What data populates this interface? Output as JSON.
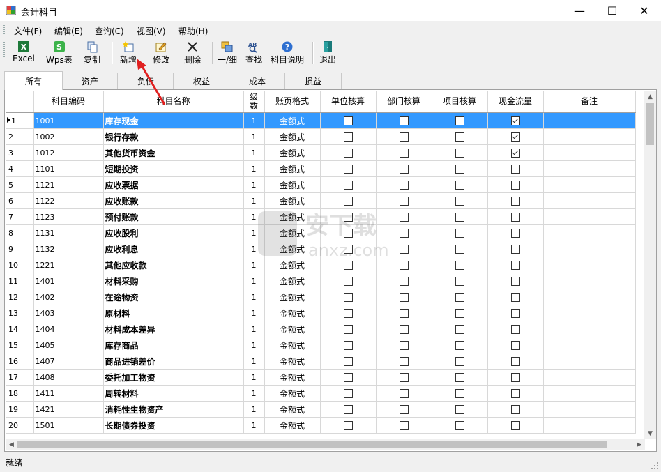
{
  "window": {
    "title": "会计科目",
    "minimize": "—",
    "maximize": "☐",
    "close": "✕"
  },
  "menu": [
    "文件(F)",
    "编辑(E)",
    "查询(C)",
    "视图(V)",
    "帮助(H)"
  ],
  "toolbar": {
    "excel": "Excel",
    "wps": "Wps表",
    "copy": "复制",
    "add": "新增",
    "edit": "修改",
    "delete": "删除",
    "level": "一/细",
    "find": "查找",
    "help": "科目说明",
    "exit": "退出"
  },
  "tabs": [
    "所有",
    "资产",
    "负债",
    "权益",
    "成本",
    "损益"
  ],
  "columns": {
    "code": "科目编码",
    "name": "科目名称",
    "level": "级数",
    "format": "账页格式",
    "unit": "单位核算",
    "dept": "部门核算",
    "project": "项目核算",
    "cash": "现金流量",
    "remark": "备注"
  },
  "rows": [
    {
      "no": "1",
      "code": "1001",
      "name": "库存现金",
      "level": "1",
      "format": "金额式",
      "unit": false,
      "dept": false,
      "project": false,
      "cash": true,
      "remark": ""
    },
    {
      "no": "2",
      "code": "1002",
      "name": "银行存款",
      "level": "1",
      "format": "金额式",
      "unit": false,
      "dept": false,
      "project": false,
      "cash": true,
      "remark": ""
    },
    {
      "no": "3",
      "code": "1012",
      "name": "其他货币资金",
      "level": "1",
      "format": "金额式",
      "unit": false,
      "dept": false,
      "project": false,
      "cash": true,
      "remark": ""
    },
    {
      "no": "4",
      "code": "1101",
      "name": "短期投资",
      "level": "1",
      "format": "金额式",
      "unit": false,
      "dept": false,
      "project": false,
      "cash": false,
      "remark": ""
    },
    {
      "no": "5",
      "code": "1121",
      "name": "应收票据",
      "level": "1",
      "format": "金额式",
      "unit": false,
      "dept": false,
      "project": false,
      "cash": false,
      "remark": ""
    },
    {
      "no": "6",
      "code": "1122",
      "name": "应收账款",
      "level": "1",
      "format": "金额式",
      "unit": false,
      "dept": false,
      "project": false,
      "cash": false,
      "remark": ""
    },
    {
      "no": "7",
      "code": "1123",
      "name": "预付账款",
      "level": "1",
      "format": "金额式",
      "unit": false,
      "dept": false,
      "project": false,
      "cash": false,
      "remark": ""
    },
    {
      "no": "8",
      "code": "1131",
      "name": "应收股利",
      "level": "1",
      "format": "金额式",
      "unit": false,
      "dept": false,
      "project": false,
      "cash": false,
      "remark": ""
    },
    {
      "no": "9",
      "code": "1132",
      "name": "应收利息",
      "level": "1",
      "format": "金额式",
      "unit": false,
      "dept": false,
      "project": false,
      "cash": false,
      "remark": ""
    },
    {
      "no": "10",
      "code": "1221",
      "name": "其他应收款",
      "level": "1",
      "format": "金额式",
      "unit": false,
      "dept": false,
      "project": false,
      "cash": false,
      "remark": ""
    },
    {
      "no": "11",
      "code": "1401",
      "name": "材料采购",
      "level": "1",
      "format": "金额式",
      "unit": false,
      "dept": false,
      "project": false,
      "cash": false,
      "remark": ""
    },
    {
      "no": "12",
      "code": "1402",
      "name": "在途物资",
      "level": "1",
      "format": "金额式",
      "unit": false,
      "dept": false,
      "project": false,
      "cash": false,
      "remark": ""
    },
    {
      "no": "13",
      "code": "1403",
      "name": "原材料",
      "level": "1",
      "format": "金额式",
      "unit": false,
      "dept": false,
      "project": false,
      "cash": false,
      "remark": ""
    },
    {
      "no": "14",
      "code": "1404",
      "name": "材料成本差异",
      "level": "1",
      "format": "金额式",
      "unit": false,
      "dept": false,
      "project": false,
      "cash": false,
      "remark": ""
    },
    {
      "no": "15",
      "code": "1405",
      "name": "库存商品",
      "level": "1",
      "format": "金额式",
      "unit": false,
      "dept": false,
      "project": false,
      "cash": false,
      "remark": ""
    },
    {
      "no": "16",
      "code": "1407",
      "name": "商品进销差价",
      "level": "1",
      "format": "金额式",
      "unit": false,
      "dept": false,
      "project": false,
      "cash": false,
      "remark": ""
    },
    {
      "no": "17",
      "code": "1408",
      "name": "委托加工物资",
      "level": "1",
      "format": "金额式",
      "unit": false,
      "dept": false,
      "project": false,
      "cash": false,
      "remark": ""
    },
    {
      "no": "18",
      "code": "1411",
      "name": "周转材料",
      "level": "1",
      "format": "金额式",
      "unit": false,
      "dept": false,
      "project": false,
      "cash": false,
      "remark": ""
    },
    {
      "no": "19",
      "code": "1421",
      "name": "消耗性生物资产",
      "level": "1",
      "format": "金额式",
      "unit": false,
      "dept": false,
      "project": false,
      "cash": false,
      "remark": ""
    },
    {
      "no": "20",
      "code": "1501",
      "name": "长期债券投资",
      "level": "1",
      "format": "金额式",
      "unit": false,
      "dept": false,
      "project": false,
      "cash": false,
      "remark": ""
    }
  ],
  "status": "就绪",
  "watermark": "安下载 anxz.com",
  "colors": {
    "selection": "#3399ff",
    "annotation_arrow": "#e02020"
  }
}
